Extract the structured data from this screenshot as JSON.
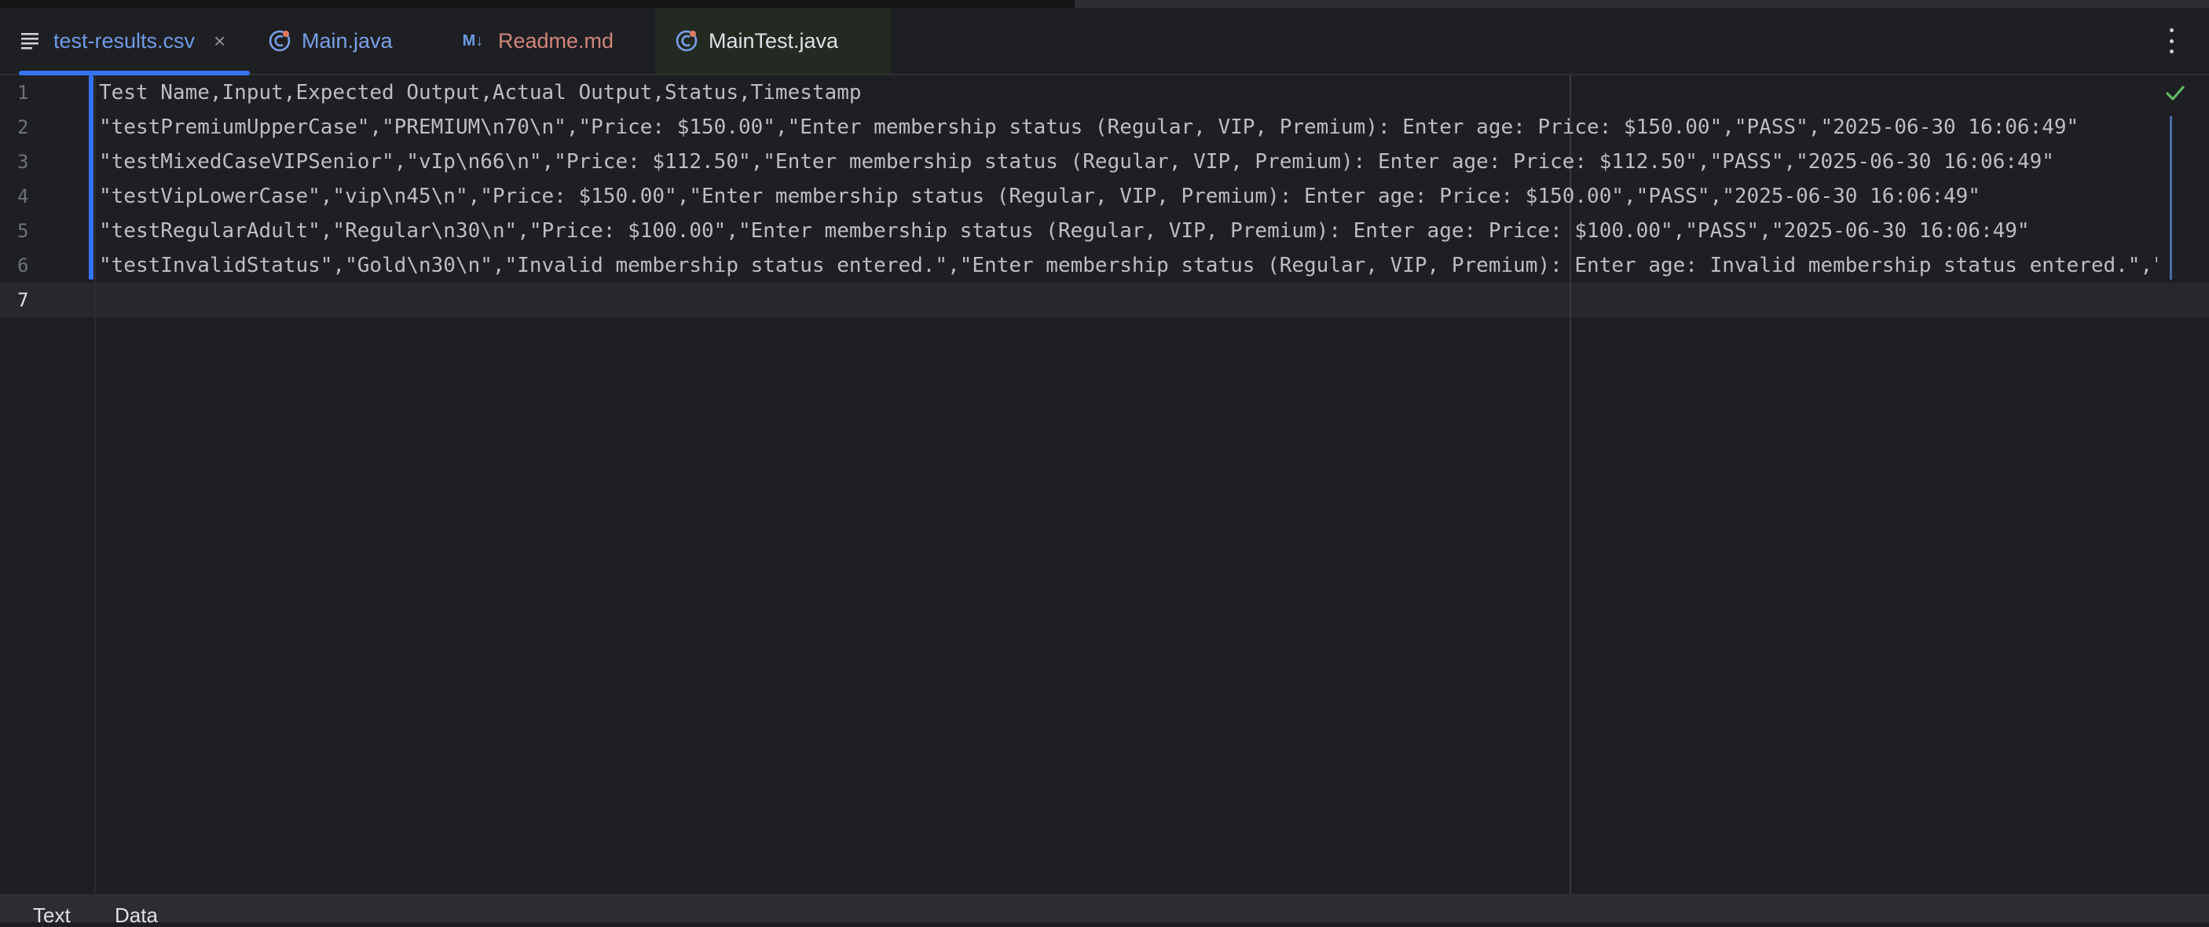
{
  "tabs": [
    {
      "label": "test-results.csv",
      "icon": "text-file-icon",
      "active": true
    },
    {
      "label": "Main.java",
      "icon": "java-class-icon"
    },
    {
      "label": "Readme.md",
      "icon": "markdown-icon",
      "icon_text": "M↓"
    },
    {
      "label": "MainTest.java",
      "icon": "java-class-icon"
    }
  ],
  "close_glyph": "×",
  "editor": {
    "line_numbers": [
      "1",
      "2",
      "3",
      "4",
      "5",
      "6",
      "7"
    ],
    "lines": [
      "Test Name,Input,Expected Output,Actual Output,Status,Timestamp",
      "\"testPremiumUpperCase\",\"PREMIUM\\n70\\n\",\"Price: $150.00\",\"Enter membership status (Regular, VIP, Premium): Enter age: Price: $150.00\",\"PASS\",\"2025-06-30 16:06:49\"",
      "\"testMixedCaseVIPSenior\",\"vIp\\n66\\n\",\"Price: $112.50\",\"Enter membership status (Regular, VIP, Premium): Enter age: Price: $112.50\",\"PASS\",\"2025-06-30 16:06:49\"",
      "\"testVipLowerCase\",\"vip\\n45\\n\",\"Price: $150.00\",\"Enter membership status (Regular, VIP, Premium): Enter age: Price: $150.00\",\"PASS\",\"2025-06-30 16:06:49\"",
      "\"testRegularAdult\",\"Regular\\n30\\n\",\"Price: $100.00\",\"Enter membership status (Regular, VIP, Premium): Enter age: Price: $100.00\",\"PASS\",\"2025-06-30 16:06:49\"",
      "\"testInvalidStatus\",\"Gold\\n30\\n\",\"Invalid membership status entered.\",\"Enter membership status (Regular, VIP, Premium): Enter age: Invalid membership status entered.\",\"PAS",
      ""
    ]
  },
  "bottom_tabs": [
    "Text",
    "Data"
  ],
  "colors": {
    "accent": "#3574f0",
    "check": "#5fb865"
  }
}
